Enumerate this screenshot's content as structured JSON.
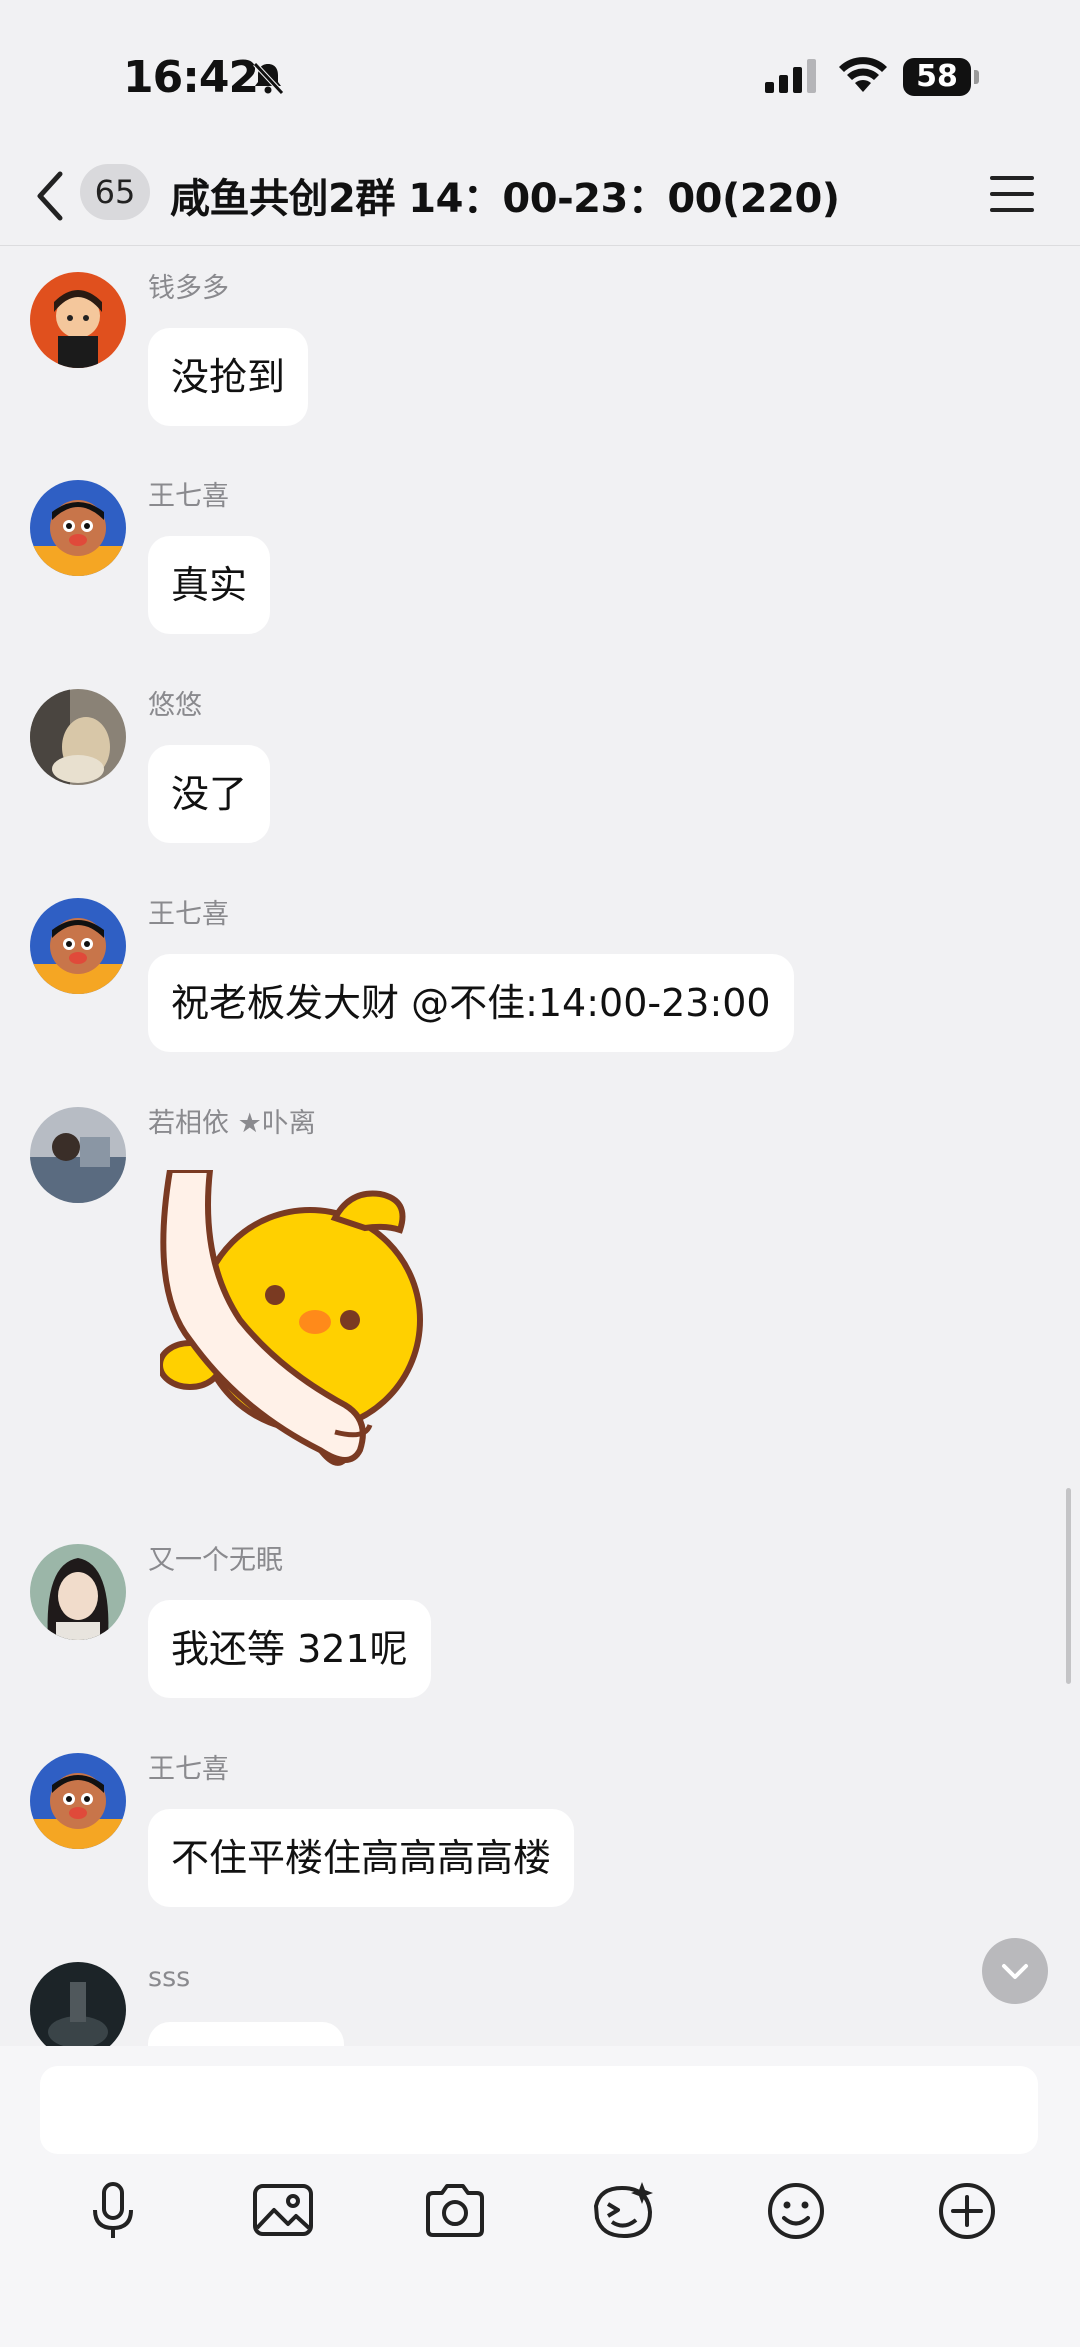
{
  "status_bar": {
    "time": "16:42",
    "battery": "58"
  },
  "header": {
    "unread_count": "65",
    "title": "咸鱼共创2群 14：00-23：00(220)"
  },
  "messages": [
    {
      "sender": "钱多多",
      "text": "没抢到"
    },
    {
      "sender": "王七喜",
      "text": "真实"
    },
    {
      "sender": "悠悠",
      "text": "没了"
    },
    {
      "sender": "王七喜",
      "text": "祝老板发大财 @不佳:14:00-23:00"
    },
    {
      "sender": "若相依 ★卟离",
      "text": ""
    },
    {
      "sender": "又一个无眠",
      "text": "我还等 321呢"
    },
    {
      "sender": "王七喜",
      "text": "不住平楼住高高高高楼"
    },
    {
      "sender": "sss",
      "text": ""
    }
  ],
  "input": {
    "placeholder": ""
  },
  "toolbar_icons": [
    "microphone-icon",
    "image-icon",
    "camera-icon",
    "sticker-icon",
    "emoji-icon",
    "plus-icon"
  ],
  "colors": {
    "background": "#f1f1f3",
    "bubble": "#ffffff",
    "sender_name": "#8a8a8e"
  }
}
